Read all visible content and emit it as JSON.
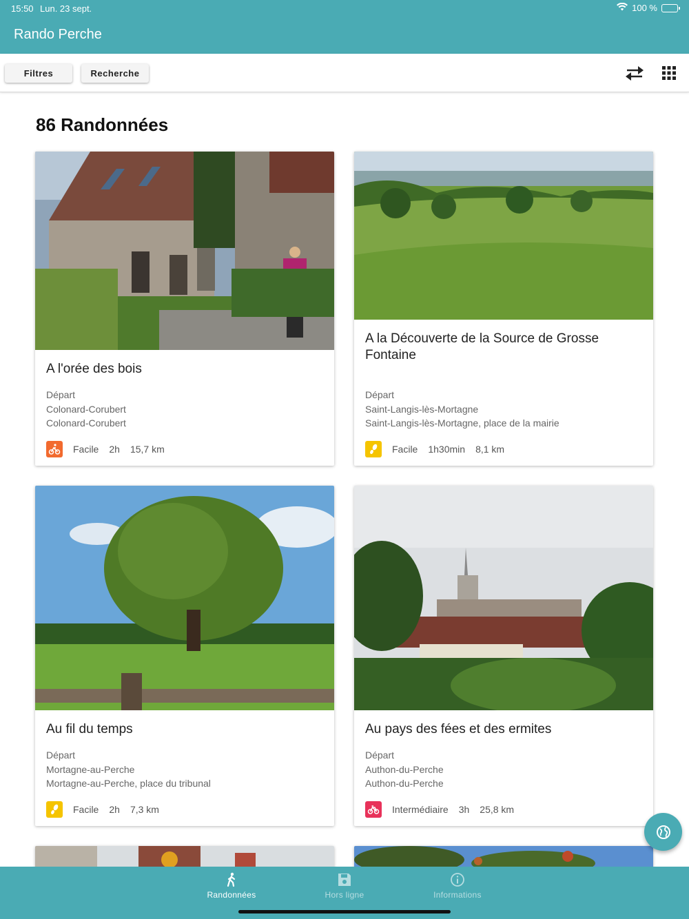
{
  "status": {
    "time": "15:50",
    "date": "Lun. 23 sept.",
    "battery": "100 %"
  },
  "app": {
    "title": "Rando Perche"
  },
  "toolbar": {
    "filters_label": "Filtres",
    "search_label": "Recherche"
  },
  "main": {
    "heading": "86 Randonnées",
    "cards": [
      {
        "title": "A l'orée des bois",
        "depart_label": "Départ",
        "town": "Colonard-Corubert",
        "place": "Colonard-Corubert",
        "difficulty": "Facile",
        "duration": "2h",
        "distance": "15,7 km",
        "activity": "mountain-bike-icon",
        "badge_color": "#f26a2e"
      },
      {
        "title": "A la Découverte de la Source de Grosse Fontaine",
        "depart_label": "Départ",
        "town": "Saint-Langis-lès-Mortagne",
        "place": "Saint-Langis-lès-Mortagne, place de la mairie",
        "difficulty": "Facile",
        "duration": "1h30min",
        "distance": "8,1 km",
        "activity": "footprint-icon",
        "badge_color": "#f5c400"
      },
      {
        "title": "Au fil du temps",
        "depart_label": "Départ",
        "town": "Mortagne-au-Perche",
        "place": "Mortagne-au-Perche, place du tribunal",
        "difficulty": "Facile",
        "duration": "2h",
        "distance": "7,3 km",
        "activity": "footprint-icon",
        "badge_color": "#f5c400"
      },
      {
        "title": "Au pays des fées et des ermites",
        "depart_label": "Départ",
        "town": "Authon-du-Perche",
        "place": "Authon-du-Perche",
        "difficulty": "Intermédiaire",
        "duration": "3h",
        "distance": "25,8 km",
        "activity": "bicycle-icon",
        "badge_color": "#e8325a"
      }
    ]
  },
  "bottom_nav": {
    "items": [
      {
        "label": "Randonnées",
        "icon": "hiker-icon",
        "active": true
      },
      {
        "label": "Hors ligne",
        "icon": "save-icon",
        "active": false
      },
      {
        "label": "Informations",
        "icon": "info-icon",
        "active": false
      }
    ]
  },
  "colors": {
    "primary": "#4aabb4"
  }
}
